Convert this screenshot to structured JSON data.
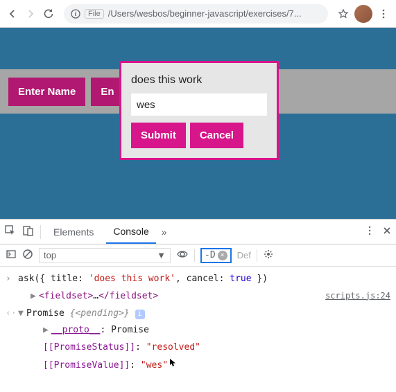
{
  "browser": {
    "url_prefix": "File",
    "url": "/Users/wesbos/beginner-javascript/exercises/7..."
  },
  "page": {
    "btn1": "Enter Name",
    "btn2_partial": "En"
  },
  "modal": {
    "title": "does this work",
    "input_value": "wes",
    "submit": "Submit",
    "cancel": "Cancel"
  },
  "devtools": {
    "tabs": {
      "elements": "Elements",
      "console": "Console"
    },
    "context": "top",
    "filter_value": "-D",
    "filter_hint": "Def",
    "source_link": "scripts.js:24"
  },
  "console": {
    "input_line": "ask({ title: 'does this work', cancel: true })",
    "fieldset_open": "<fieldset>",
    "fieldset_mid": "…",
    "fieldset_close": "</fieldset>",
    "promise_label": "Promise ",
    "promise_state": "{<pending>}",
    "proto_key": "__proto__",
    "proto_val": ": Promise",
    "status_key": "[[PromiseStatus]]",
    "status_val": "\"resolved\"",
    "value_key": "[[PromiseValue]]",
    "value_val": "\"wes\""
  }
}
